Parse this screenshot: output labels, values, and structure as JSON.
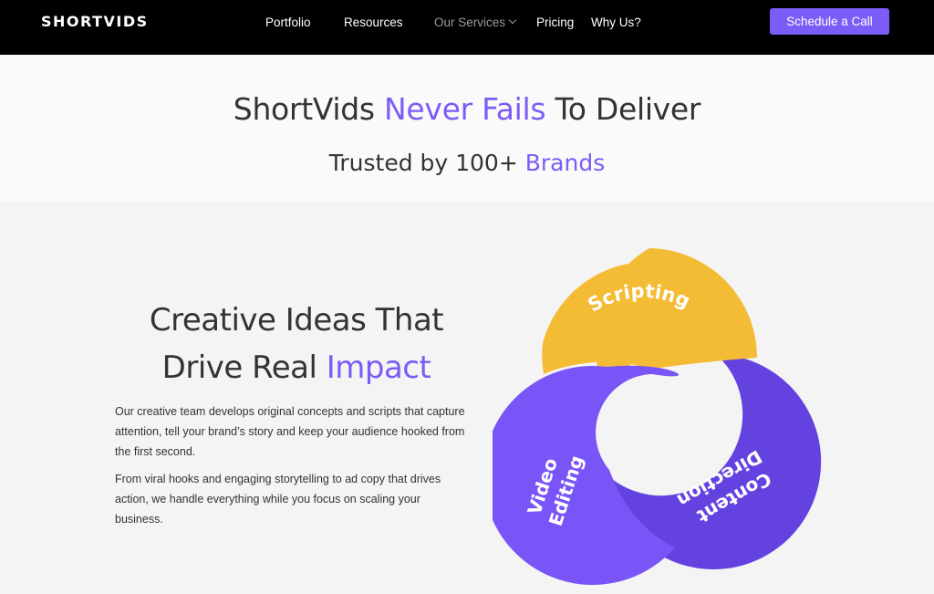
{
  "nav": {
    "logo": "SHORTVIDS",
    "links": [
      "Portfolio",
      "Resources",
      "Our Services",
      "Pricing",
      "Why Us?"
    ],
    "cta": "Schedule a Call"
  },
  "hero": {
    "title_part1": "ShortVids ",
    "title_accent": "Never Fails",
    "title_part2": " To Deliver",
    "subtitle_part1": "Trusted by 100+ ",
    "subtitle_accent": "Brands"
  },
  "feature": {
    "title_line1": "Creative Ideas That",
    "title_line2_part1": "Drive Real ",
    "title_accent": "Impact",
    "paragraph1": "Our creative team develops original concepts and scripts that capture attention, tell your brand’s story and keep your audience hooked from the first second.",
    "paragraph2": "From viral hooks and engaging storytelling to ad copy that drives action, we handle everything while you focus on scaling your business."
  },
  "diagram": {
    "labels": {
      "scripting": "Scripting",
      "video_line1": "Video",
      "video_line2": "Editing",
      "content_line1": "Content",
      "content_line2": "Direction"
    },
    "colors": {
      "yellow": "#f4bc35",
      "purple_light": "#7955f7",
      "purple_dark": "#6442e0",
      "accent": "#7c5cf6"
    }
  }
}
